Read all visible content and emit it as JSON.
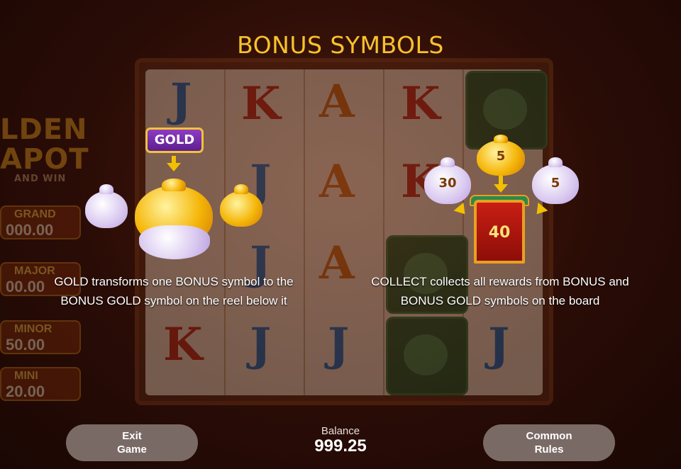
{
  "title": "BONUS SYMBOLS",
  "background": {
    "logo_line1": "LDEN",
    "logo_line2": "APOT",
    "logo_line3": "AND WIN",
    "jackpots": [
      {
        "label": "GRAND",
        "value": "000.00"
      },
      {
        "label": "MAJOR",
        "value": "00.00"
      },
      {
        "label": "MINOR",
        "value": "50.00"
      },
      {
        "label": "MINI",
        "value": "20.00"
      }
    ]
  },
  "gold": {
    "badge": "GOLD",
    "description_line1": "GOLD transforms one BONUS symbol to the",
    "description_line2": "BONUS GOLD symbol on the reel below it"
  },
  "collect": {
    "left_value": "30",
    "top_value": "5",
    "right_value": "5",
    "door_value": "40",
    "description_line1": "COLLECT collects all rewards from BONUS and",
    "description_line2": "BONUS GOLD symbols on the board"
  },
  "footer": {
    "exit_line1": "Exit",
    "exit_line2": "Game",
    "balance_label": "Balance",
    "balance_value": "999.25",
    "rules_line1": "Common",
    "rules_line2": "Rules"
  },
  "colors": {
    "title": "#f7c22a",
    "button_bg": "#7a6a66",
    "arrow": "#f2c000"
  }
}
